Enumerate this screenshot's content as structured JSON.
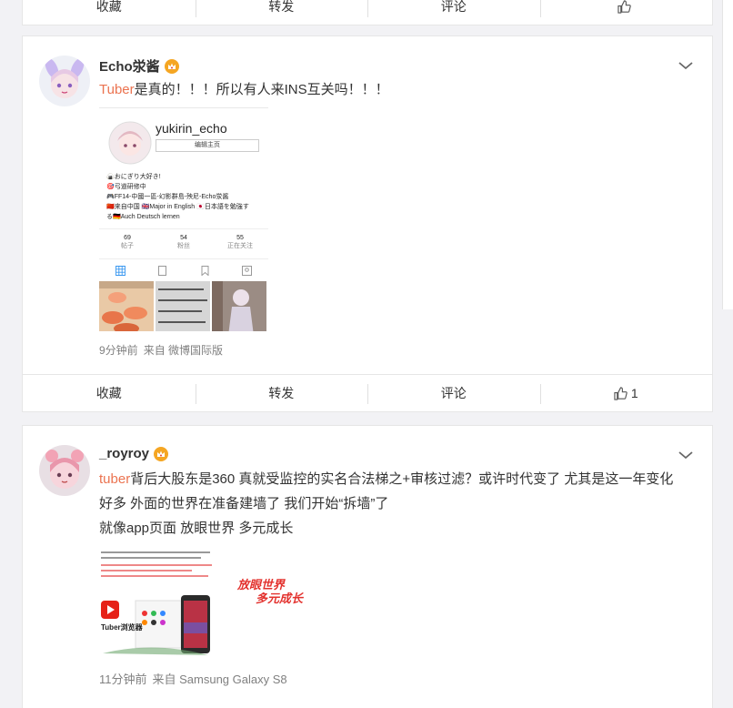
{
  "top_actions": {
    "favorite": "收藏",
    "repost": "转发",
    "comment": "评论",
    "like_count": ""
  },
  "post1": {
    "username": "Echo泶酱",
    "text_link": "Tuber",
    "text_body": "是真的！！！所以有人来INS互关吗！！！",
    "image": {
      "handle": "yukirin_echo",
      "edit_profile": "编辑主页",
      "bio_lines": [
        "🍙おにぎり大好き!",
        "🎯弓道研修中",
        "🎮FF14-中國一區-幻影群島-殃尼-Echo泶酱",
        "🇨🇳来自中国 🇬🇧Major in English 🇯🇵日本語を勉強す",
        "る🇩🇪Auch Deutsch lernen"
      ],
      "stats": [
        {
          "num": "69",
          "label": "帖子"
        },
        {
          "num": "54",
          "label": "粉丝"
        },
        {
          "num": "55",
          "label": "正在关注"
        }
      ]
    },
    "time": "9分钟前",
    "source": "来自 微博国际版",
    "actions": {
      "favorite": "收藏",
      "repost": "转发",
      "comment": "评论",
      "like_count": "1"
    }
  },
  "post2": {
    "username": "_royroy",
    "text_link": "tuber",
    "text_body": "背后大股东是360 真就受监控的实名合法梯之+审核过滤？或许时代变了 尤其是这一年变化好多 外面的世界在准备建墙了 我们开始“拆墙”了",
    "text_line3": "就像app页面 放眼世界 多元成长",
    "image": {
      "slogan1": "放眼世界",
      "slogan2": "多元成长",
      "brand": "Tuber浏览器"
    },
    "time": "11分钟前",
    "source": "来自 Samsung Galaxy S8"
  },
  "colors": {
    "link": "#eb7350",
    "crown": "#f5a623"
  }
}
